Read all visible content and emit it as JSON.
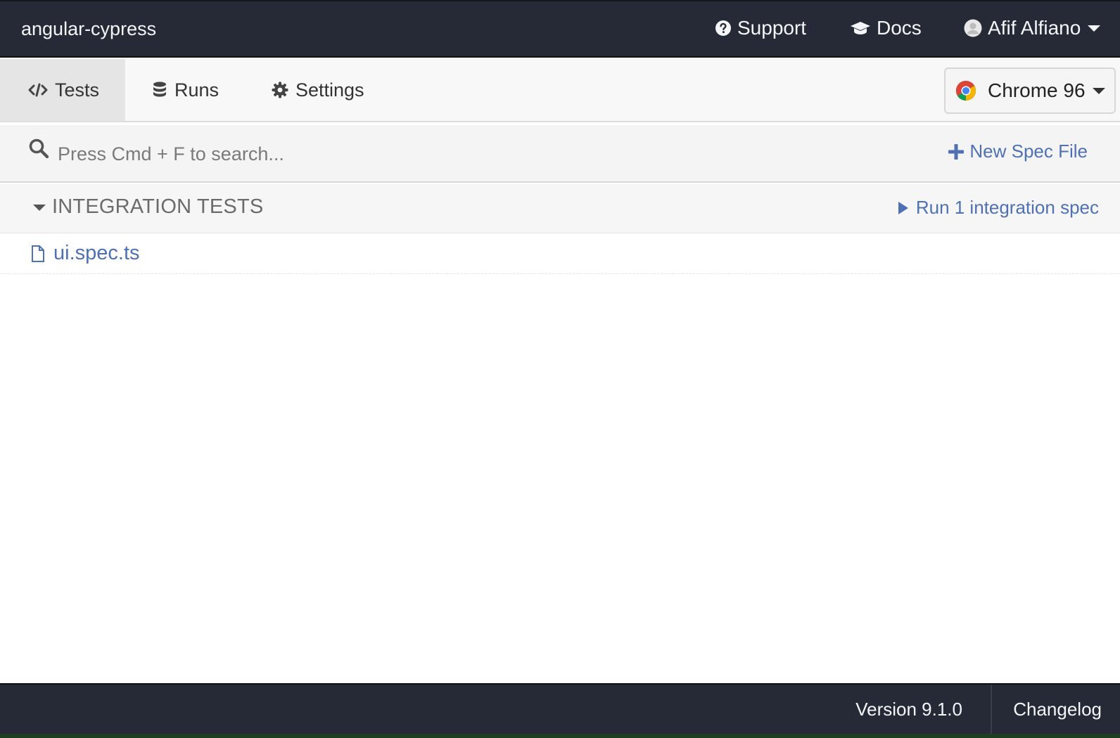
{
  "header": {
    "project_name": "angular-cypress",
    "support_label": "Support",
    "docs_label": "Docs",
    "user_name": "Afif Alfiano"
  },
  "tabs": [
    {
      "label": "Tests",
      "icon": "code-icon",
      "active": true
    },
    {
      "label": "Runs",
      "icon": "database-icon",
      "active": false
    },
    {
      "label": "Settings",
      "icon": "gear-icon",
      "active": false
    }
  ],
  "browser": {
    "label": "Chrome 96",
    "icon": "chrome-icon"
  },
  "search": {
    "placeholder": "Press Cmd + F to search...",
    "value": ""
  },
  "new_spec_label": "New Spec File",
  "integration": {
    "title": "INTEGRATION TESTS",
    "run_label": "Run 1 integration spec",
    "specs": [
      {
        "name": "ui.spec.ts"
      }
    ]
  },
  "footer": {
    "version": "Version 9.1.0",
    "changelog": "Changelog"
  },
  "colors": {
    "dark_bar": "#252a36",
    "link_blue": "#4f71b3"
  }
}
